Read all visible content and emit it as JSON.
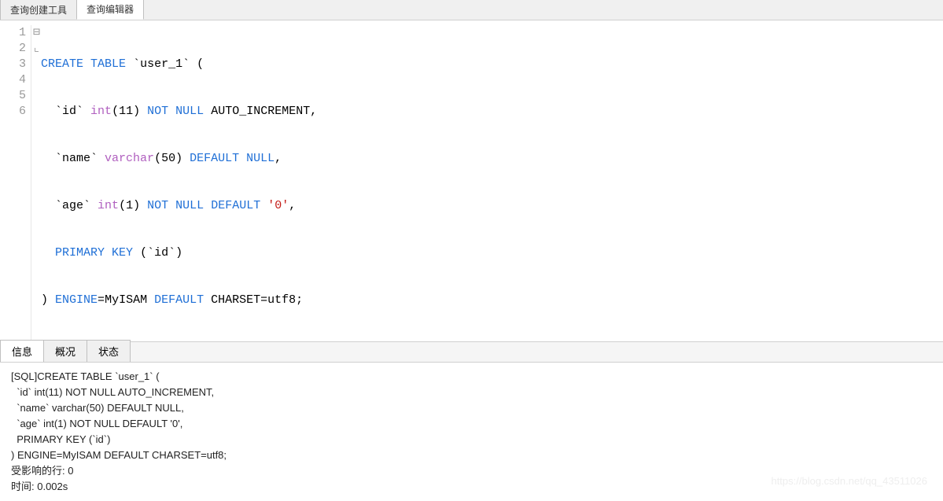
{
  "topTabs": {
    "builder": "查询创建工具",
    "editor": "查询编辑器"
  },
  "code": {
    "lineNums": [
      "1",
      "2",
      "3",
      "4",
      "5",
      "6"
    ],
    "fold": [
      "⊟",
      "",
      "",
      "",
      "",
      "⌞"
    ],
    "l1": {
      "kw1": "CREATE",
      "kw2": "TABLE",
      "tbl": "`user_1`",
      "open": "("
    },
    "l2": {
      "col": "`id`",
      "typ": "int",
      "lp": "(",
      "n": "11",
      "rp": ")",
      "kw1": "NOT",
      "kw2": "NULL",
      "ai": "AUTO_INCREMENT,",
      "indent": "  "
    },
    "l3": {
      "col": "`name`",
      "typ": "varchar",
      "lp": "(",
      "n": "50",
      "rp": ")",
      "kw1": "DEFAULT",
      "kw2": "NULL",
      "comma": ",",
      "indent": "  "
    },
    "l4": {
      "col": "`age`",
      "typ": "int",
      "lp": "(",
      "n": "1",
      "rp": ")",
      "kw1": "NOT",
      "kw2": "NULL",
      "kw3": "DEFAULT",
      "val": "'0'",
      "comma": ",",
      "indent": "  "
    },
    "l5": {
      "kw1": "PRIMARY",
      "kw2": "KEY",
      "lp": "(",
      "col": "`id`",
      "rp": ")",
      "indent": "  "
    },
    "l6": {
      "rp": ")",
      "kw1": "ENGINE",
      "eq": "=",
      "eng": "MyISAM",
      "kw2": "DEFAULT",
      "cs1": "CHARSET=utf8;"
    }
  },
  "resultTabs": {
    "info": "信息",
    "profile": "概况",
    "status": "状态"
  },
  "result": {
    "l1": "[SQL]CREATE TABLE `user_1` (",
    "l2": "  `id` int(11) NOT NULL AUTO_INCREMENT,",
    "l3": "  `name` varchar(50) DEFAULT NULL,",
    "l4": "  `age` int(1) NOT NULL DEFAULT '0',",
    "l5": "  PRIMARY KEY (`id`)",
    "l6": ") ENGINE=MyISAM DEFAULT CHARSET=utf8;",
    "l7": "受影响的行: 0",
    "l8": "时间: 0.002s"
  },
  "watermark": "https://blog.csdn.net/qq_43511026"
}
